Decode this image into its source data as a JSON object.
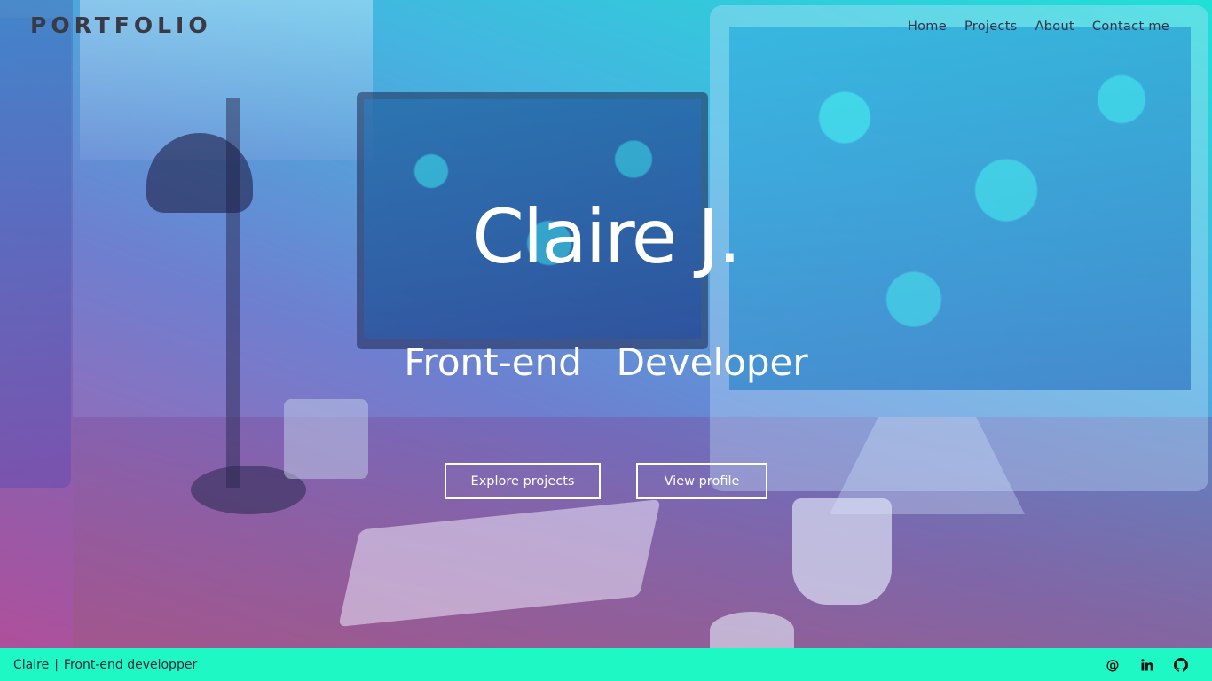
{
  "brand": {
    "logo": "PORTFOLIO"
  },
  "nav": {
    "items": [
      {
        "label": "Home"
      },
      {
        "label": "Projects"
      },
      {
        "label": "About"
      },
      {
        "label": "Contact me"
      }
    ]
  },
  "hero": {
    "name": "Claire J.",
    "role": "Front-end  Developer",
    "buttons": {
      "explore": "Explore projects",
      "profile": "View profile"
    }
  },
  "footer": {
    "name": "Claire",
    "separator": "|",
    "title": "Front-end developper",
    "social": [
      {
        "icon": "at-email-icon"
      },
      {
        "icon": "linkedin-icon"
      },
      {
        "icon": "github-icon"
      }
    ]
  },
  "colors": {
    "footer_bg": "#1ef8c4",
    "gradient_top_right": "#1fe0d6",
    "gradient_bottom_left": "#b65aa3",
    "text_dark": "#33334a",
    "hero_text": "#ffffff"
  }
}
